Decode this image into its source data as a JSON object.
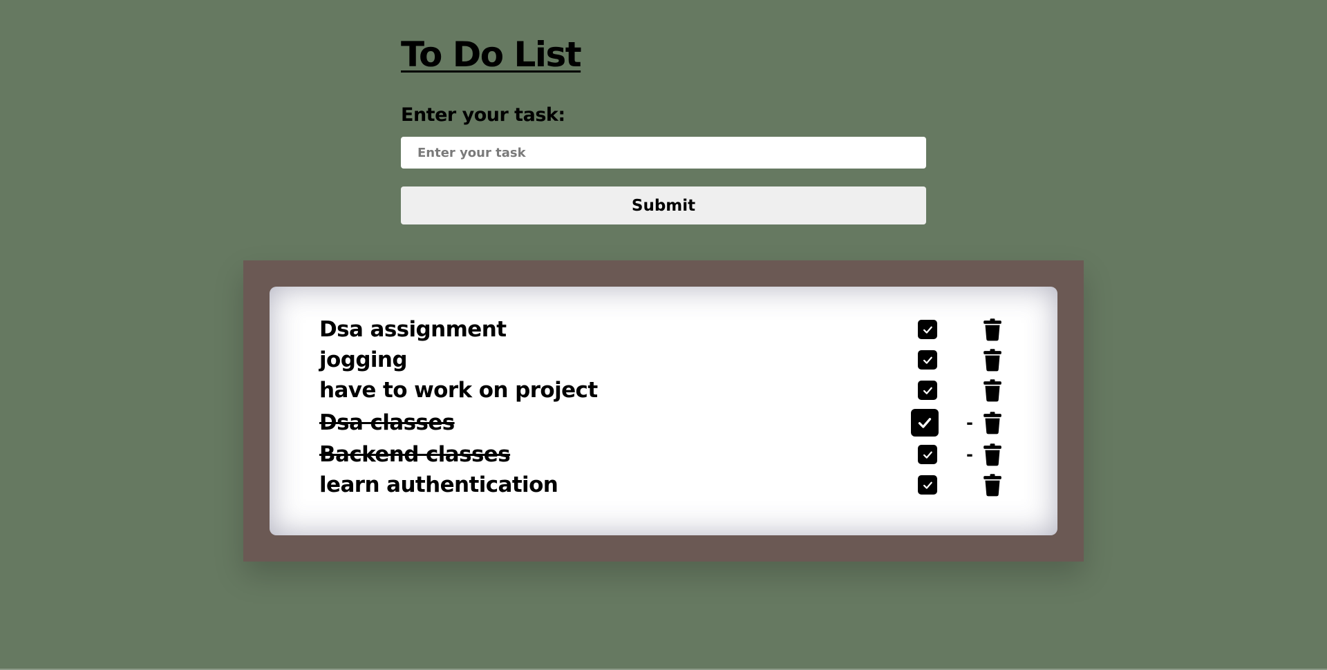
{
  "title": "To Do List",
  "form": {
    "label": "Enter your task:",
    "input_placeholder": "Enter your task",
    "input_value": "",
    "submit_label": "Submit"
  },
  "tasks": [
    {
      "text": "Dsa assignment",
      "completed": false,
      "marker": ""
    },
    {
      "text": "jogging",
      "completed": false,
      "marker": ""
    },
    {
      "text": "have to work on project",
      "completed": false,
      "marker": ""
    },
    {
      "text": "Dsa classes",
      "completed": true,
      "marker": "-"
    },
    {
      "text": "Backend classes",
      "completed": true,
      "marker": "-"
    },
    {
      "text": "learn authentication",
      "completed": false,
      "marker": ""
    }
  ],
  "icons": {
    "checkbox": "check-square-icon",
    "delete": "trash-icon"
  },
  "colors": {
    "background": "#667961",
    "frame": "#6b5954",
    "card": "#ffffff",
    "button": "#efefef"
  }
}
